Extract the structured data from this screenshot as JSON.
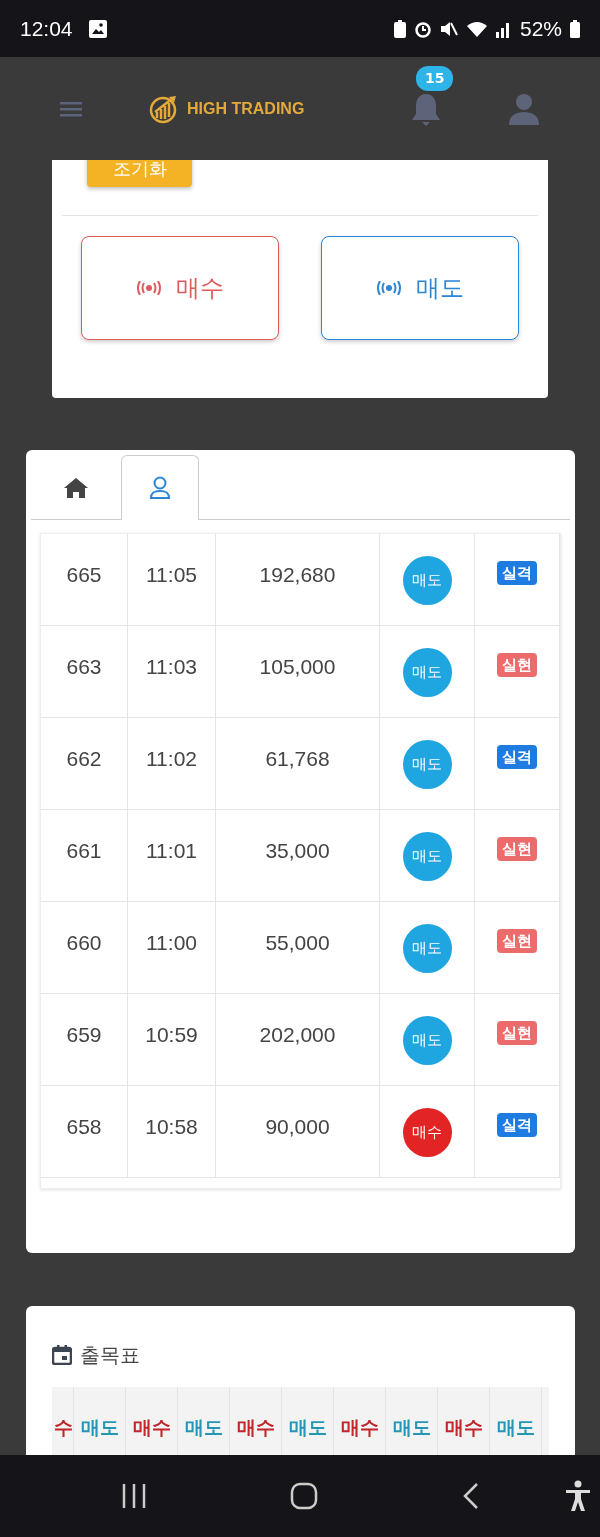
{
  "status_bar": {
    "time": "12:04",
    "battery": "52%"
  },
  "header": {
    "brand": "HIGH TRADING",
    "notification_count": "15"
  },
  "order_panel": {
    "reset_button": "조기화",
    "buttons": [
      {
        "label": "매수",
        "color": "#e05a5a"
      },
      {
        "label": "매도",
        "color": "#2a86d6"
      }
    ]
  },
  "tabs": [
    {
      "kind": "home",
      "selected": false
    },
    {
      "kind": "user",
      "selected": true
    }
  ],
  "table": {
    "rows": [
      {
        "no": "665",
        "time": "11:05",
        "amount": "192,680",
        "side": {
          "label": "매도",
          "color": "#1fa5e0"
        },
        "result": {
          "label": "실격",
          "color": "#1e7be0"
        }
      },
      {
        "no": "663",
        "time": "11:03",
        "amount": "105,000",
        "side": {
          "label": "매도",
          "color": "#1fa5e0"
        },
        "result": {
          "label": "실현",
          "color": "#ec6c6c"
        }
      },
      {
        "no": "662",
        "time": "11:02",
        "amount": "61,768",
        "side": {
          "label": "매도",
          "color": "#1fa5e0"
        },
        "result": {
          "label": "실격",
          "color": "#1e7be0"
        }
      },
      {
        "no": "661",
        "time": "11:01",
        "amount": "35,000",
        "side": {
          "label": "매도",
          "color": "#1fa5e0"
        },
        "result": {
          "label": "실현",
          "color": "#ec6c6c"
        }
      },
      {
        "no": "660",
        "time": "11:00",
        "amount": "55,000",
        "side": {
          "label": "매도",
          "color": "#1fa5e0"
        },
        "result": {
          "label": "실현",
          "color": "#ec6c6c"
        }
      },
      {
        "no": "659",
        "time": "10:59",
        "amount": "202,000",
        "side": {
          "label": "매도",
          "color": "#1fa5e0"
        },
        "result": {
          "label": "실현",
          "color": "#ec6c6c"
        }
      },
      {
        "no": "658",
        "time": "10:58",
        "amount": "90,000",
        "side": {
          "label": "매수",
          "color": "#e32424"
        },
        "result": {
          "label": "실격",
          "color": "#1e7be0"
        }
      }
    ]
  },
  "schedule": {
    "title": "출목표",
    "cells": [
      {
        "label": "수",
        "color": "#c0262d"
      },
      {
        "label": "매도",
        "color": "#2595b5"
      },
      {
        "label": "매수",
        "color": "#c0262d"
      },
      {
        "label": "매도",
        "color": "#2595b5"
      },
      {
        "label": "매수",
        "color": "#c0262d"
      },
      {
        "label": "매도",
        "color": "#2595b5"
      },
      {
        "label": "매수",
        "color": "#c0262d"
      },
      {
        "label": "매도",
        "color": "#2595b5"
      },
      {
        "label": "매수",
        "color": "#c0262d"
      },
      {
        "label": "매도",
        "color": "#2595b5"
      }
    ]
  }
}
